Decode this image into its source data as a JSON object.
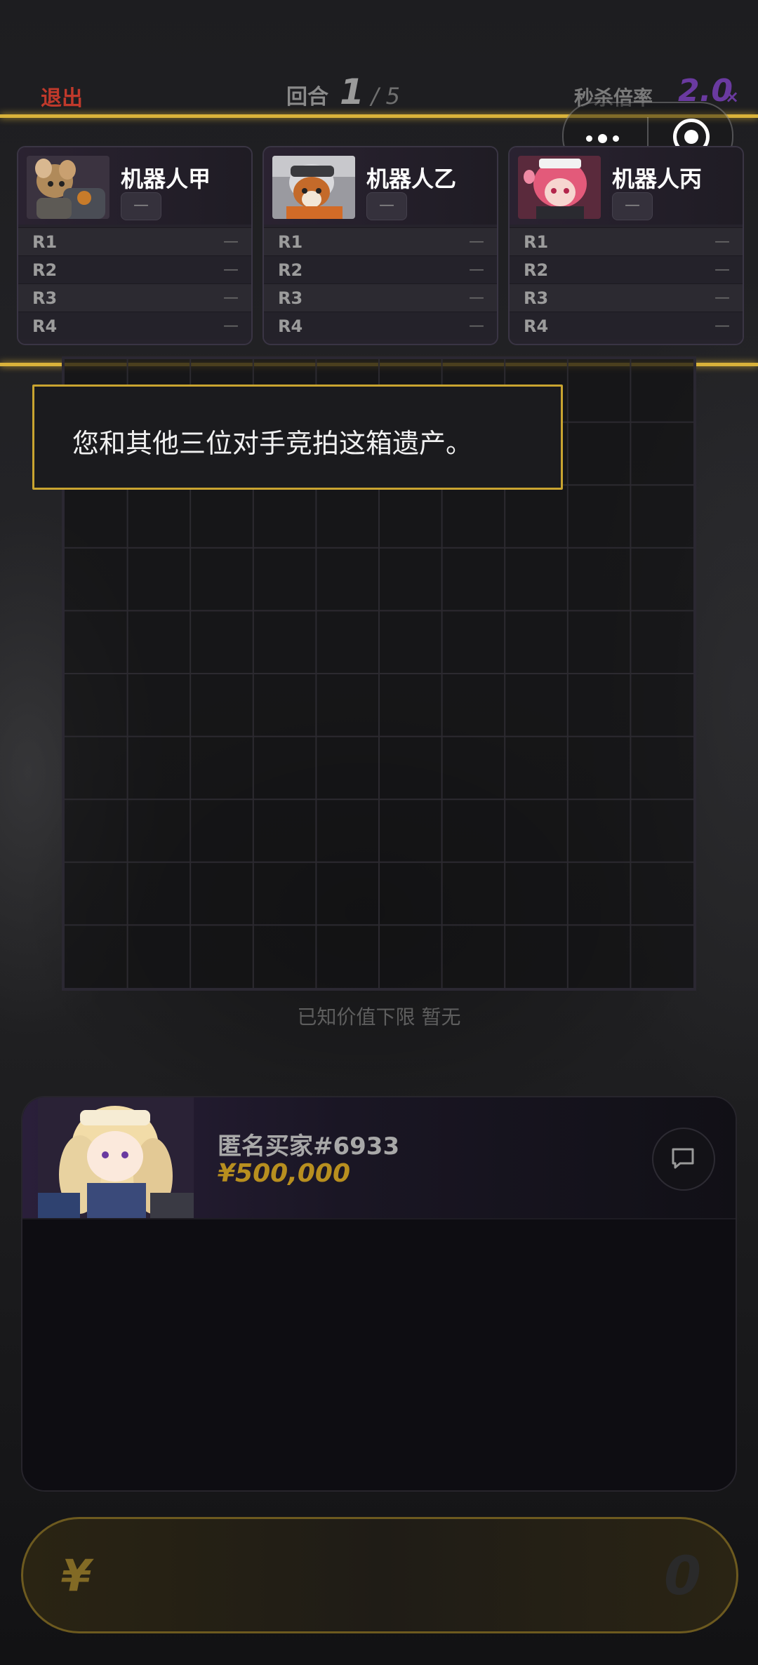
{
  "header": {
    "exit_label": "退出",
    "round_label": "回合",
    "round_current": "1",
    "round_sep": "/",
    "round_total": "5",
    "kill_label": "秒杀倍率",
    "kill_value": "2.0",
    "kill_suffix": "×"
  },
  "colors": {
    "accent_gold": "#d9b23a",
    "exit_red": "#c0392b",
    "multiplier_purple": "#6a3aa0"
  },
  "opponents": [
    {
      "name": "机器人甲",
      "badge": "—",
      "rounds": [
        {
          "label": "R1",
          "value": "—"
        },
        {
          "label": "R2",
          "value": "—"
        },
        {
          "label": "R3",
          "value": "—"
        },
        {
          "label": "R4",
          "value": "—"
        }
      ]
    },
    {
      "name": "机器人乙",
      "badge": "—",
      "rounds": [
        {
          "label": "R1",
          "value": "—"
        },
        {
          "label": "R2",
          "value": "—"
        },
        {
          "label": "R3",
          "value": "—"
        },
        {
          "label": "R4",
          "value": "—"
        }
      ]
    },
    {
      "name": "机器人丙",
      "badge": "—",
      "rounds": [
        {
          "label": "R1",
          "value": "—"
        },
        {
          "label": "R2",
          "value": "—"
        },
        {
          "label": "R3",
          "value": "—"
        },
        {
          "label": "R4",
          "value": "—"
        }
      ]
    }
  ],
  "notice": "您和其他三位对手竞拍这箱遗产。",
  "known_value": "已知价值下限 暂无",
  "seller": {
    "name": "匿名买家#6933",
    "price": "¥500,000"
  },
  "bid": {
    "currency": "¥",
    "amount": "0"
  },
  "icons": [
    "more-dots-icon",
    "close-target-icon",
    "chat-icon"
  ]
}
